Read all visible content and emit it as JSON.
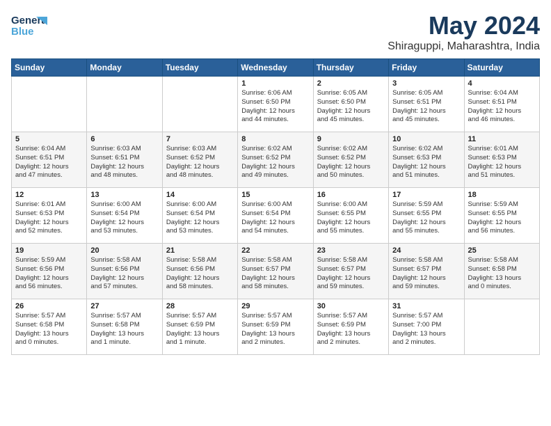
{
  "header": {
    "logo_line1": "General",
    "logo_line2": "Blue",
    "title": "May 2024",
    "subtitle": "Shiraguppi, Maharashtra, India"
  },
  "days_of_week": [
    "Sunday",
    "Monday",
    "Tuesday",
    "Wednesday",
    "Thursday",
    "Friday",
    "Saturday"
  ],
  "weeks": [
    [
      {
        "day": "",
        "content": ""
      },
      {
        "day": "",
        "content": ""
      },
      {
        "day": "",
        "content": ""
      },
      {
        "day": "1",
        "content": "Sunrise: 6:06 AM\nSunset: 6:50 PM\nDaylight: 12 hours\nand 44 minutes."
      },
      {
        "day": "2",
        "content": "Sunrise: 6:05 AM\nSunset: 6:50 PM\nDaylight: 12 hours\nand 45 minutes."
      },
      {
        "day": "3",
        "content": "Sunrise: 6:05 AM\nSunset: 6:51 PM\nDaylight: 12 hours\nand 45 minutes."
      },
      {
        "day": "4",
        "content": "Sunrise: 6:04 AM\nSunset: 6:51 PM\nDaylight: 12 hours\nand 46 minutes."
      }
    ],
    [
      {
        "day": "5",
        "content": "Sunrise: 6:04 AM\nSunset: 6:51 PM\nDaylight: 12 hours\nand 47 minutes."
      },
      {
        "day": "6",
        "content": "Sunrise: 6:03 AM\nSunset: 6:51 PM\nDaylight: 12 hours\nand 48 minutes."
      },
      {
        "day": "7",
        "content": "Sunrise: 6:03 AM\nSunset: 6:52 PM\nDaylight: 12 hours\nand 48 minutes."
      },
      {
        "day": "8",
        "content": "Sunrise: 6:02 AM\nSunset: 6:52 PM\nDaylight: 12 hours\nand 49 minutes."
      },
      {
        "day": "9",
        "content": "Sunrise: 6:02 AM\nSunset: 6:52 PM\nDaylight: 12 hours\nand 50 minutes."
      },
      {
        "day": "10",
        "content": "Sunrise: 6:02 AM\nSunset: 6:53 PM\nDaylight: 12 hours\nand 51 minutes."
      },
      {
        "day": "11",
        "content": "Sunrise: 6:01 AM\nSunset: 6:53 PM\nDaylight: 12 hours\nand 51 minutes."
      }
    ],
    [
      {
        "day": "12",
        "content": "Sunrise: 6:01 AM\nSunset: 6:53 PM\nDaylight: 12 hours\nand 52 minutes."
      },
      {
        "day": "13",
        "content": "Sunrise: 6:00 AM\nSunset: 6:54 PM\nDaylight: 12 hours\nand 53 minutes."
      },
      {
        "day": "14",
        "content": "Sunrise: 6:00 AM\nSunset: 6:54 PM\nDaylight: 12 hours\nand 53 minutes."
      },
      {
        "day": "15",
        "content": "Sunrise: 6:00 AM\nSunset: 6:54 PM\nDaylight: 12 hours\nand 54 minutes."
      },
      {
        "day": "16",
        "content": "Sunrise: 6:00 AM\nSunset: 6:55 PM\nDaylight: 12 hours\nand 55 minutes."
      },
      {
        "day": "17",
        "content": "Sunrise: 5:59 AM\nSunset: 6:55 PM\nDaylight: 12 hours\nand 55 minutes."
      },
      {
        "day": "18",
        "content": "Sunrise: 5:59 AM\nSunset: 6:55 PM\nDaylight: 12 hours\nand 56 minutes."
      }
    ],
    [
      {
        "day": "19",
        "content": "Sunrise: 5:59 AM\nSunset: 6:56 PM\nDaylight: 12 hours\nand 56 minutes."
      },
      {
        "day": "20",
        "content": "Sunrise: 5:58 AM\nSunset: 6:56 PM\nDaylight: 12 hours\nand 57 minutes."
      },
      {
        "day": "21",
        "content": "Sunrise: 5:58 AM\nSunset: 6:56 PM\nDaylight: 12 hours\nand 58 minutes."
      },
      {
        "day": "22",
        "content": "Sunrise: 5:58 AM\nSunset: 6:57 PM\nDaylight: 12 hours\nand 58 minutes."
      },
      {
        "day": "23",
        "content": "Sunrise: 5:58 AM\nSunset: 6:57 PM\nDaylight: 12 hours\nand 59 minutes."
      },
      {
        "day": "24",
        "content": "Sunrise: 5:58 AM\nSunset: 6:57 PM\nDaylight: 12 hours\nand 59 minutes."
      },
      {
        "day": "25",
        "content": "Sunrise: 5:58 AM\nSunset: 6:58 PM\nDaylight: 13 hours\nand 0 minutes."
      }
    ],
    [
      {
        "day": "26",
        "content": "Sunrise: 5:57 AM\nSunset: 6:58 PM\nDaylight: 13 hours\nand 0 minutes."
      },
      {
        "day": "27",
        "content": "Sunrise: 5:57 AM\nSunset: 6:58 PM\nDaylight: 13 hours\nand 1 minute."
      },
      {
        "day": "28",
        "content": "Sunrise: 5:57 AM\nSunset: 6:59 PM\nDaylight: 13 hours\nand 1 minute."
      },
      {
        "day": "29",
        "content": "Sunrise: 5:57 AM\nSunset: 6:59 PM\nDaylight: 13 hours\nand 2 minutes."
      },
      {
        "day": "30",
        "content": "Sunrise: 5:57 AM\nSunset: 6:59 PM\nDaylight: 13 hours\nand 2 minutes."
      },
      {
        "day": "31",
        "content": "Sunrise: 5:57 AM\nSunset: 7:00 PM\nDaylight: 13 hours\nand 2 minutes."
      },
      {
        "day": "",
        "content": ""
      }
    ]
  ]
}
